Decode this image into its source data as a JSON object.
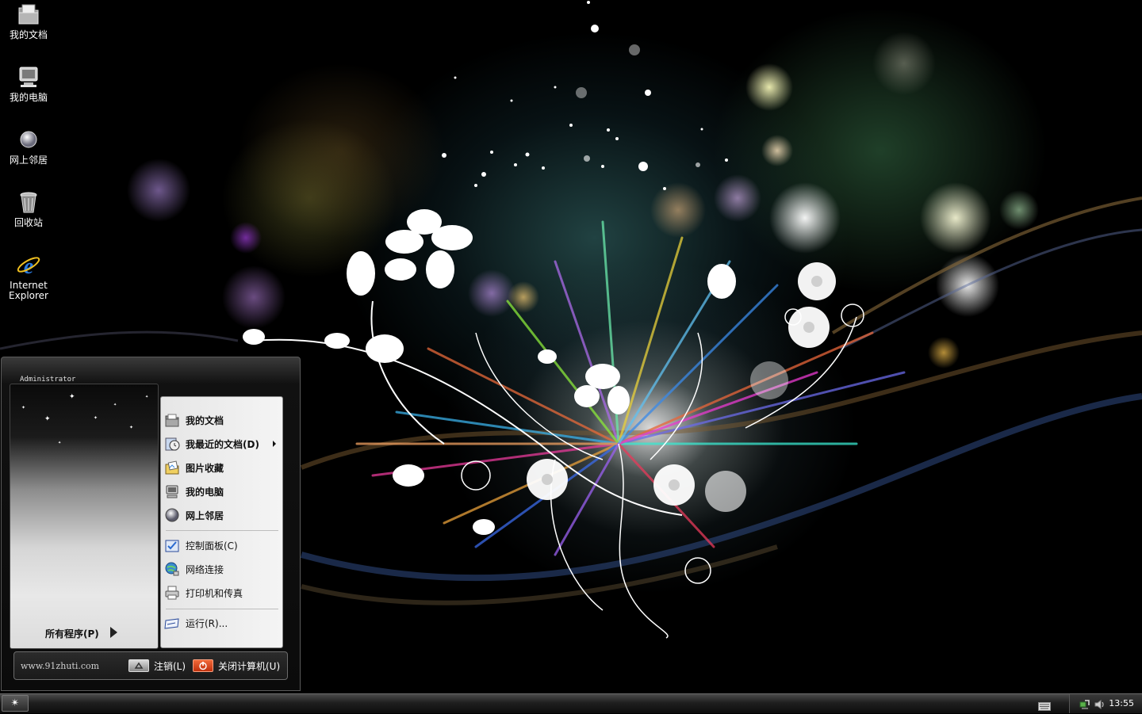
{
  "desktop": {
    "icons": [
      {
        "label": "我的文档",
        "icon": "my-documents-icon"
      },
      {
        "label": "我的电脑",
        "icon": "my-computer-icon"
      },
      {
        "label": "网上邻居",
        "icon": "network-places-icon"
      },
      {
        "label": "回收站",
        "icon": "recycle-bin-icon"
      },
      {
        "label_line1": "Internet",
        "label_line2": "Explorer",
        "icon": "internet-explorer-icon"
      }
    ]
  },
  "start_menu": {
    "user_name": "Administrator",
    "all_programs": "所有程序(P)",
    "items": [
      {
        "label": "我的文档",
        "icon": "my-documents-icon"
      },
      {
        "label": "我最近的文档(D)",
        "icon": "recent-documents-icon",
        "has_submenu": true
      },
      {
        "label": "图片收藏",
        "icon": "my-pictures-icon"
      },
      {
        "label": "我的电脑",
        "icon": "my-computer-icon"
      },
      {
        "label": "网上邻居",
        "icon": "network-places-icon"
      },
      {
        "label": "控制面板(C)",
        "icon": "control-panel-icon"
      },
      {
        "label": "网络连接",
        "icon": "network-connections-icon"
      },
      {
        "label": "打印机和传真",
        "icon": "printers-fax-icon"
      },
      {
        "label": "运行(R)...",
        "icon": "run-icon"
      }
    ],
    "site_text": "www.91zhuti.com",
    "logoff_label": "注销(L)",
    "shutdown_label": "关闭计算机(U)"
  },
  "taskbar": {
    "start_icon": "start-star-icon",
    "clock": "13:55",
    "tray_icons": [
      "network-tray-icon",
      "volume-tray-icon"
    ],
    "language_icon": "keyboard-icon"
  },
  "colors": {
    "shutdown_red": "#d8401c",
    "background": "#000000"
  }
}
